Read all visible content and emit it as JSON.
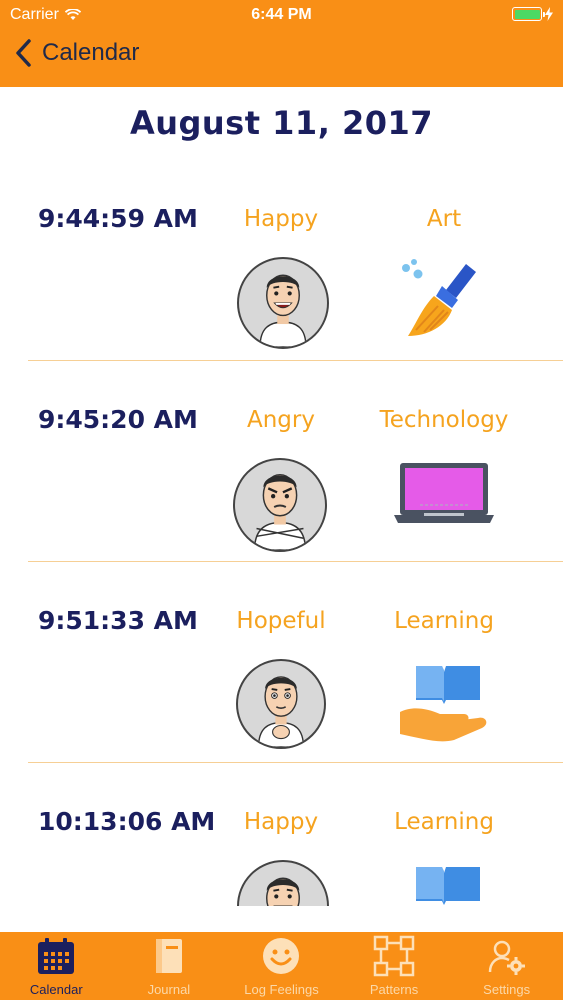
{
  "status_bar": {
    "carrier": "Carrier",
    "time": "6:44 PM"
  },
  "nav": {
    "back_label": "Calendar"
  },
  "date_title": "August 11, 2017",
  "entries": [
    {
      "time": "9:44:59 AM",
      "feeling": "Happy",
      "category": "Art",
      "avatar": "happy-avatar-icon",
      "category_icon": "paintbrush-icon"
    },
    {
      "time": "9:45:20 AM",
      "feeling": "Angry",
      "category": "Technology",
      "avatar": "angry-avatar-icon",
      "category_icon": "laptop-icon"
    },
    {
      "time": "9:51:33 AM",
      "feeling": "Hopeful",
      "category": "Learning",
      "avatar": "hopeful-avatar-icon",
      "category_icon": "book-hand-icon"
    },
    {
      "time": "10:13:06 AM",
      "feeling": "Happy",
      "category": "Learning",
      "avatar": "happy-avatar-icon",
      "category_icon": "book-hand-icon"
    }
  ],
  "tabs": [
    {
      "label": "Calendar",
      "icon": "calendar-icon",
      "active": true
    },
    {
      "label": "Journal",
      "icon": "journal-icon",
      "active": false
    },
    {
      "label": "Log Feelings",
      "icon": "smiley-icon",
      "active": false
    },
    {
      "label": "Patterns",
      "icon": "patterns-icon",
      "active": false
    },
    {
      "label": "Settings",
      "icon": "settings-icon",
      "active": false
    }
  ],
  "colors": {
    "accent": "#f98f16",
    "title_navy": "#1b1f5e",
    "label_orange": "#f5a31f",
    "divider": "#f6cf95"
  }
}
